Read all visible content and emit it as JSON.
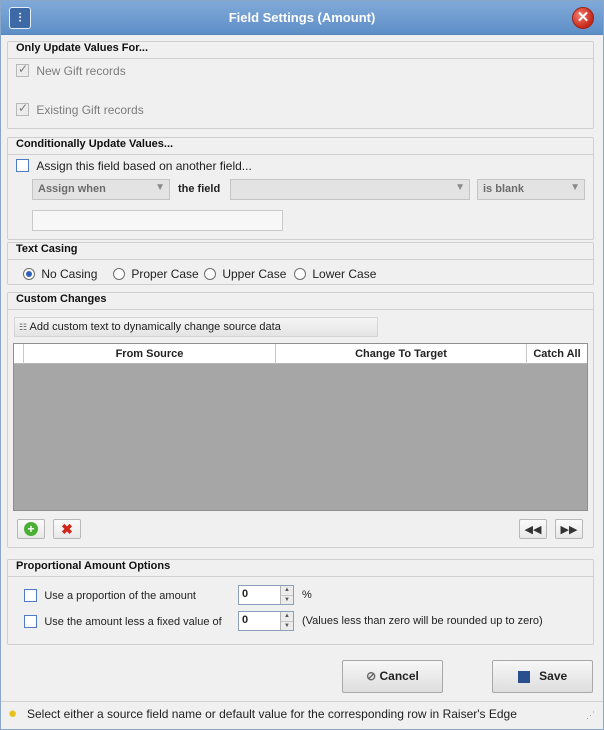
{
  "window": {
    "title": "Field Settings (Amount)",
    "app_icon": "settings-icon",
    "close_icon": "close-icon"
  },
  "only_update": {
    "title": "Only Update Values For...",
    "new_gift_label": "New Gift records",
    "new_gift_checked": true,
    "existing_gift_label": "Existing Gift records",
    "existing_gift_checked": true
  },
  "conditional": {
    "title": "Conditionally Update Values...",
    "assign_label": "Assign this field based on another field...",
    "assign_checked": false,
    "assign_when": "Assign when",
    "the_field_label": "the field",
    "field_value": "",
    "condition": "is blank",
    "value_text": ""
  },
  "text_casing": {
    "title": "Text Casing",
    "options": [
      "No Casing",
      "Proper Case",
      "Upper Case",
      "Lower Case"
    ],
    "selected": "No Casing"
  },
  "custom_changes": {
    "title": "Custom Changes",
    "add_button": "Add custom text to dynamically change source data",
    "columns": [
      "From Source",
      "Change To Target",
      "Catch All"
    ],
    "rows": []
  },
  "proportional": {
    "title": "Proportional Amount Options",
    "proportion_label": "Use a proportion of the amount",
    "proportion_value": "0",
    "proportion_unit": "%",
    "less_fixed_label": "Use the amount less a fixed value of",
    "less_fixed_value": "0",
    "note": "(Values less than zero will be rounded up to zero)"
  },
  "actions": {
    "cancel": "Cancel",
    "save": "Save"
  },
  "status": {
    "hint": "Select either a source field name or default value for the corresponding row in Raiser's Edge",
    "icon": "lightbulb-icon"
  },
  "colors": {
    "title_bar": "#6b97cf",
    "close": "#c6281a",
    "grid_bg": "#a6a6a6"
  }
}
